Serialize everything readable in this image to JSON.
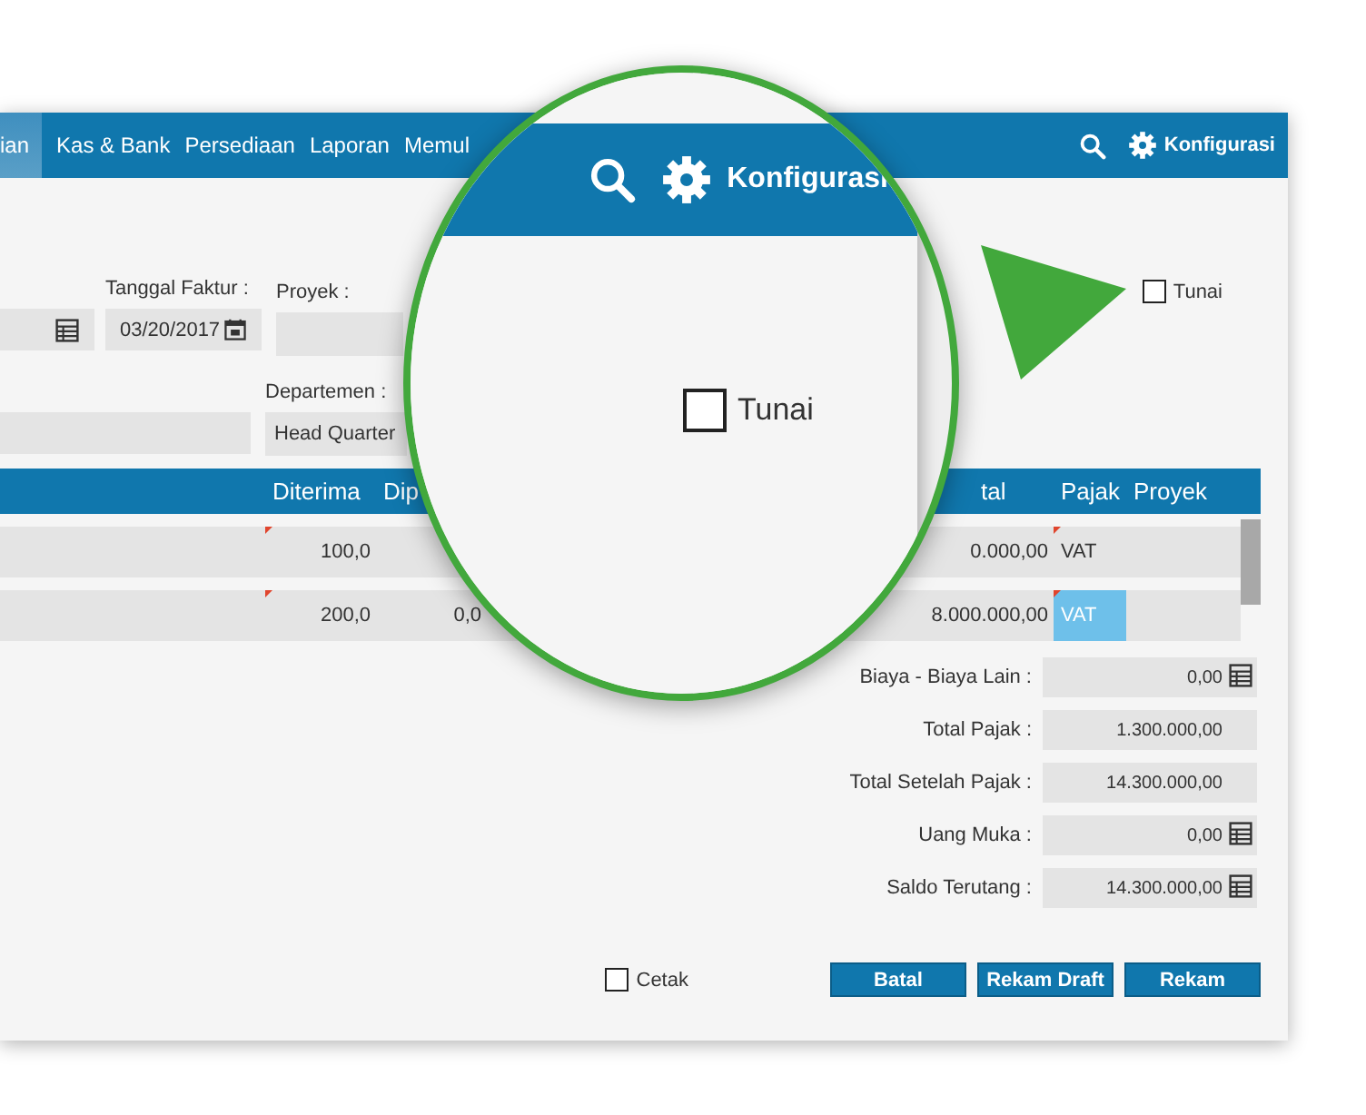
{
  "nav": {
    "items": [
      {
        "label": "ian",
        "selected": true
      },
      {
        "label": "Kas & Bank",
        "selected": false
      },
      {
        "label": "Persediaan",
        "selected": false
      },
      {
        "label": "Laporan",
        "selected": false
      },
      {
        "label": "Memul",
        "selected": false
      }
    ],
    "settings_label": "Konfigurasi"
  },
  "form": {
    "invoice_date": {
      "label": "Tanggal Faktur :",
      "value": "03/20/2017"
    },
    "project": {
      "label": "Proyek :"
    },
    "department": {
      "label": "Departemen :",
      "value": "Head Quarter"
    },
    "cash": {
      "label": "Tunai",
      "checked": false
    }
  },
  "table": {
    "columns": [
      "Diterima",
      "Dip",
      "tal",
      "Pajak",
      "Proyek"
    ],
    "rows": [
      {
        "diterima": "100,0",
        "tal": "0.000,00",
        "pajak": {
          "text": "VAT",
          "selected": false
        }
      },
      {
        "diterima": "200,0",
        "dip": "0,0",
        "tal": "8.000.000,00",
        "pajak": {
          "text": "VAT",
          "selected": true
        }
      }
    ]
  },
  "summary": [
    {
      "label": "Biaya - Biaya Lain :",
      "value": "0,00",
      "kind": "calculator"
    },
    {
      "label": "Total Pajak :",
      "value": "1.300.000,00",
      "kind": "plain"
    },
    {
      "label": "Total Setelah Pajak :",
      "value": "14.300.000,00",
      "kind": "plain"
    },
    {
      "label": "Uang Muka :",
      "value": "0,00",
      "kind": "calculator"
    },
    {
      "label": "Saldo Terutang :",
      "value": "14.300.000,00",
      "kind": "calculator"
    }
  ],
  "footer": {
    "print": {
      "label": "Cetak",
      "checked": false
    },
    "buttons": [
      "Batal",
      "Rekam Draft",
      "Rekam"
    ]
  },
  "magnifier": {
    "settings_label": "Konfigurasi",
    "cash": {
      "label": "Tunai",
      "checked": false
    }
  }
}
